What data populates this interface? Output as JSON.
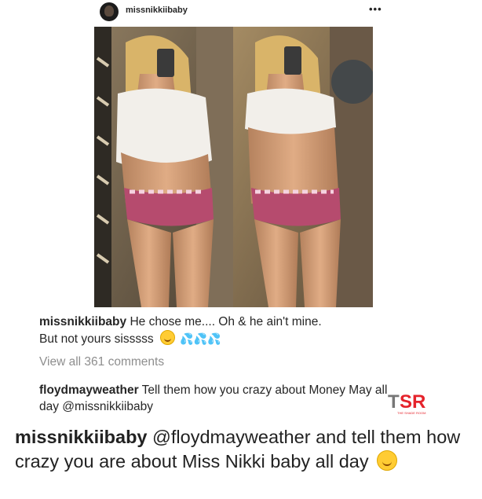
{
  "post": {
    "username": "missnikkiibaby",
    "more_label": "•••"
  },
  "caption": {
    "username": "missnikkiibaby",
    "text_line1": "He chose me.... Oh & he ain't mine.",
    "text_line2": "But not yours sisssss",
    "drops": "💦💦💦"
  },
  "view_all": "View all 361 comments",
  "comment": {
    "username": "floydmayweather",
    "text": "Tell them how you crazy about Money May all day @missnikkiibaby"
  },
  "watermark": {
    "text_t": "T",
    "text_sr": "SR",
    "tagline": "THE SHADE ROOM"
  },
  "reply": {
    "username": "missnikkiibaby",
    "mention": "@floydmayweather",
    "text": "and tell them how crazy you are about Miss Nikki baby all day"
  },
  "colors": {
    "tsr_red": "#e5232b",
    "tsr_gray": "#777777",
    "link_blue": "#3c5a99"
  },
  "icons": [
    "avatar",
    "more-icon",
    "smile-emoji",
    "sweat-drops-emoji"
  ]
}
